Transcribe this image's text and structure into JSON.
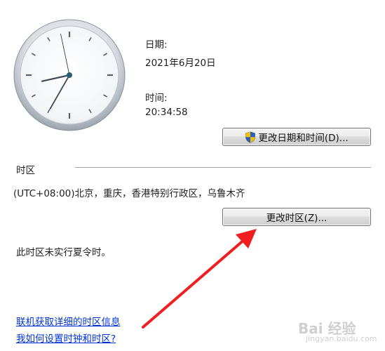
{
  "date": {
    "label": "日期:",
    "value": "2021年6月20日"
  },
  "time": {
    "label": "时间:",
    "value": "20:34:58"
  },
  "clock": {
    "hours": 20,
    "minutes": 34,
    "seconds": 58
  },
  "buttons": {
    "change_datetime": "更改日期和时间(D)...",
    "change_timezone": "更改时区(Z)..."
  },
  "timezone": {
    "section_title": "时区",
    "value": "(UTC+08:00)北京，重庆，香港特别行政区，乌鲁木齐",
    "dst_note": "此时区未实行夏令时。"
  },
  "links": {
    "online_info": "联机获取详细的时区信息",
    "how_to": "我如何设置时钟和时区?"
  },
  "watermark": {
    "text": "Bai 经验",
    "sub": "jingyan.baidu.com"
  },
  "icons": {
    "shield": "uac-shield-icon",
    "arrow": "red-arrow-annotation"
  },
  "colors": {
    "link": "#0033cc",
    "arrow": "#f01e1e",
    "accent_shield_blue": "#2a5fc4",
    "accent_shield_yellow": "#f2c200"
  }
}
